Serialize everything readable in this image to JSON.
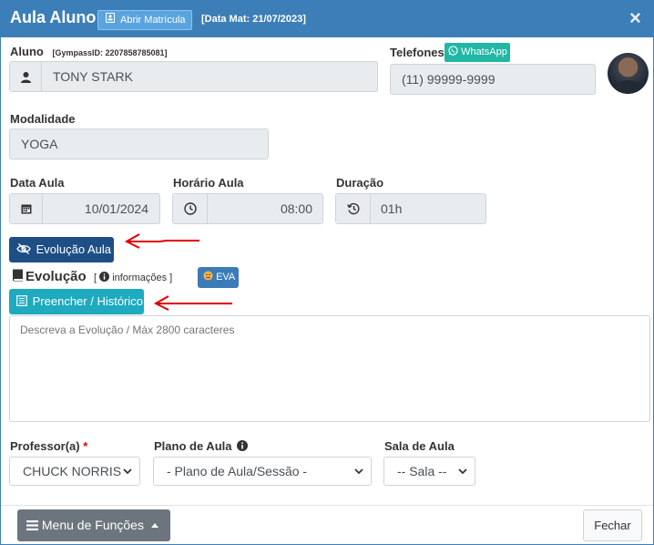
{
  "header": {
    "title": "Aula Aluno",
    "matricula_button": "Abrir Matrícula",
    "data_mat": "[Data Mat: 21/07/2023]",
    "close_symbol": "×"
  },
  "aluno": {
    "label": "Aluno",
    "gympass": "[GympassID: 2207858785081]",
    "value": "TONY STARK",
    "icon": "user-icon"
  },
  "telefones": {
    "label": "Telefones",
    "whatsapp_button": "WhatsApp",
    "value": "(11) 99999-9999"
  },
  "modalidade": {
    "label": "Modalidade",
    "value": "YOGA"
  },
  "data_aula": {
    "label": "Data Aula",
    "value": "10/01/2024",
    "icon": "calendar-icon"
  },
  "horario_aula": {
    "label": "Horário Aula",
    "value": "08:00",
    "icon": "clock-icon"
  },
  "duracao": {
    "label": "Duração",
    "value": "01h",
    "icon": "history-icon"
  },
  "evolucao_button": "Evolução Aula",
  "evolucao": {
    "title": "Evolução",
    "info_open": "[",
    "info_text": "informações ]",
    "eva_button": "EVA",
    "preencher_button": "Preencher / Histórico",
    "placeholder": "Descreva a Evolução / Máx 2800 caracteres"
  },
  "professor": {
    "label": "Professor(a)",
    "required_mark": "*",
    "value": "CHUCK NORRIS"
  },
  "plano": {
    "label": "Plano de Aula",
    "value": "- Plano de Aula/Sessão -"
  },
  "sala": {
    "label": "Sala de Aula",
    "value": "-- Sala --"
  },
  "footer": {
    "menu_button": "Menu de Funções",
    "close_button": "Fechar"
  },
  "colors": {
    "header": "#3c7fb8",
    "evolucao_button": "#1e4e86",
    "preencher_button": "#1eaabf",
    "whatsapp": "#20b7a5",
    "annotation_arrow": "#e00000"
  }
}
